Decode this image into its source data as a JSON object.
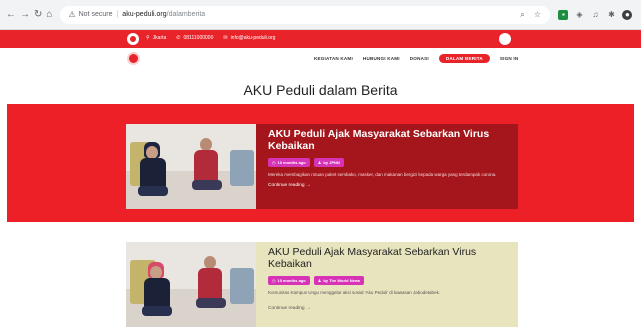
{
  "browser": {
    "security_label": "Not secure",
    "url_host": "aku-peduli.org",
    "url_path": "/dalamberita"
  },
  "topbar": {
    "contacts": [
      {
        "icon": "pin-icon",
        "label": "Jkarta"
      },
      {
        "icon": "phone-icon",
        "label": "08111000000"
      },
      {
        "icon": "mail-icon",
        "label": "info@aku-peduli.org"
      }
    ]
  },
  "nav": {
    "items": [
      "KEGIATAN KAMI",
      "HUBUNGI KAMI",
      "DONASI",
      "DALAM BERITA",
      "SIGN IN"
    ],
    "active_index": 3,
    "accent_color": "#e8232a"
  },
  "page": {
    "title": "AKU Peduli dalam Berita"
  },
  "posts": [
    {
      "title": "AKU Peduli Ajak Masyarakat Sebarkan Virus Kebaikan",
      "date": "10 months ago",
      "author": "by JPNN",
      "excerpt": "Mereka membagikan rotuan paket sembako, masker, dan makanan bergizi kepada warga yang terdampak corona.",
      "more": "Continue reading →"
    },
    {
      "title": "AKU Peduli Ajak Masyarakat Sebarkan Virus Kebaikan",
      "date": "10 months ago",
      "author": "by The World News",
      "excerpt": "Komunitas Kampus Ungu menggelar aksi sosial 'Aku Peduli' di kawasan Jabodetabek.",
      "more": "Continue reading →"
    }
  ]
}
